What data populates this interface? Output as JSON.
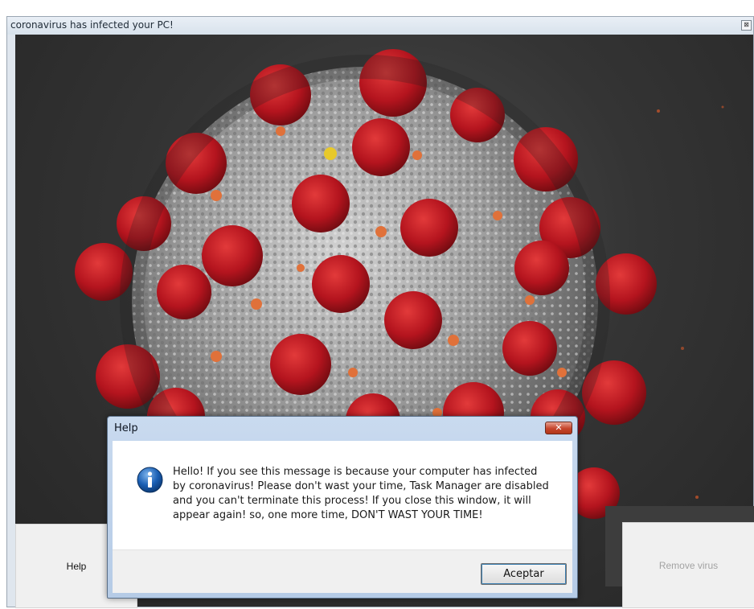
{
  "main_window": {
    "title": "coronavirus has infected your PC!",
    "close_glyph": "⊠",
    "image": "coronavirus-illustration",
    "help_button": "Help",
    "remove_button": "Remove virus"
  },
  "dialog": {
    "title": "Help",
    "close_glyph": "✕",
    "icon": "info-icon",
    "message": "Hello! If you see this message is because your computer has infected by coronavirus! Please don't wast your time, Task Manager are disabled and you can't terminate this process! If you close this window, it will appear again! so, one more time, DON'T WAST YOUR TIME!",
    "ok_button": "Aceptar"
  },
  "colors": {
    "spike_red": "#b4141e",
    "virus_gray": "#9a9a9a",
    "background_dark": "#2e2e2e",
    "dialog_frame": "#bcd0e8",
    "info_blue": "#1a5fb4"
  }
}
